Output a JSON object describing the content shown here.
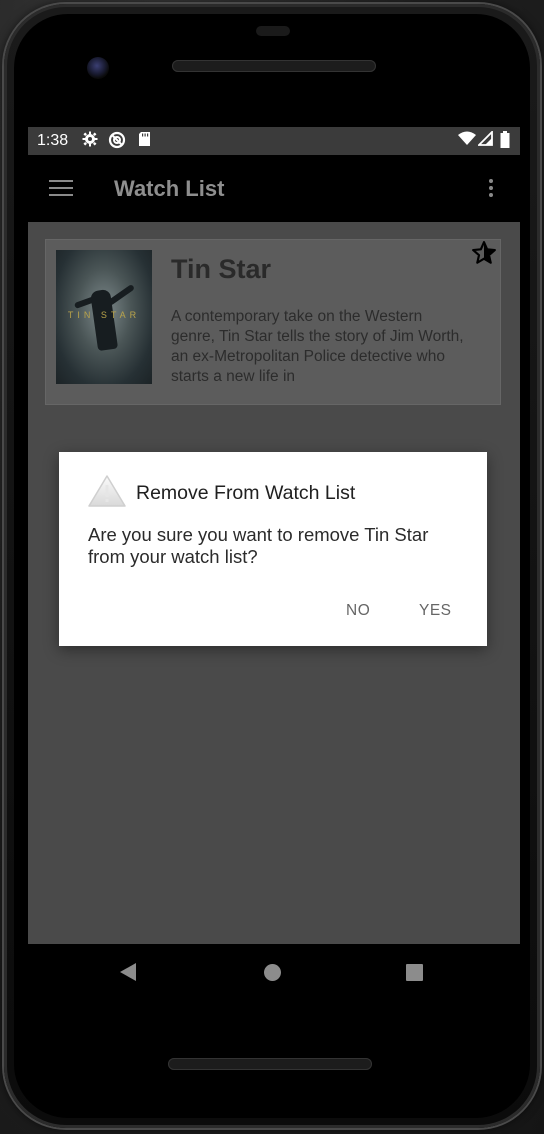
{
  "status_bar": {
    "time": "1:38",
    "left_icons": [
      "gear-icon",
      "sync-icon",
      "sd-card-icon"
    ],
    "right_icons": [
      "wifi-icon",
      "signal-icon",
      "battery-icon"
    ]
  },
  "toolbar": {
    "title": "Watch List",
    "menu_icon": "hamburger-menu-icon",
    "overflow_icon": "overflow-menu-icon"
  },
  "watch_list": {
    "items": [
      {
        "title": "Tin Star",
        "poster_text": "TIN STAR",
        "description": "A contemporary take on the Western genre, Tin Star tells the story of Jim Worth, an ex-Metropolitan Police detective who starts a new life in",
        "favorite_icon": "star-icon"
      }
    ]
  },
  "dialog": {
    "icon": "warning-icon",
    "title": "Remove From Watch List",
    "message": "Are you sure you want to remove Tin Star from your watch list?",
    "negative_label": "NO",
    "positive_label": "YES"
  },
  "nav_bar": {
    "back_icon": "back-icon",
    "home_icon": "home-icon",
    "recents_icon": "recents-icon"
  },
  "colors": {
    "toolbar": "#000000",
    "scrim_background": "#4a4a4a",
    "card": "#5c5c5c",
    "dialog": "#ffffff",
    "dialog_button_text": "#666666"
  }
}
